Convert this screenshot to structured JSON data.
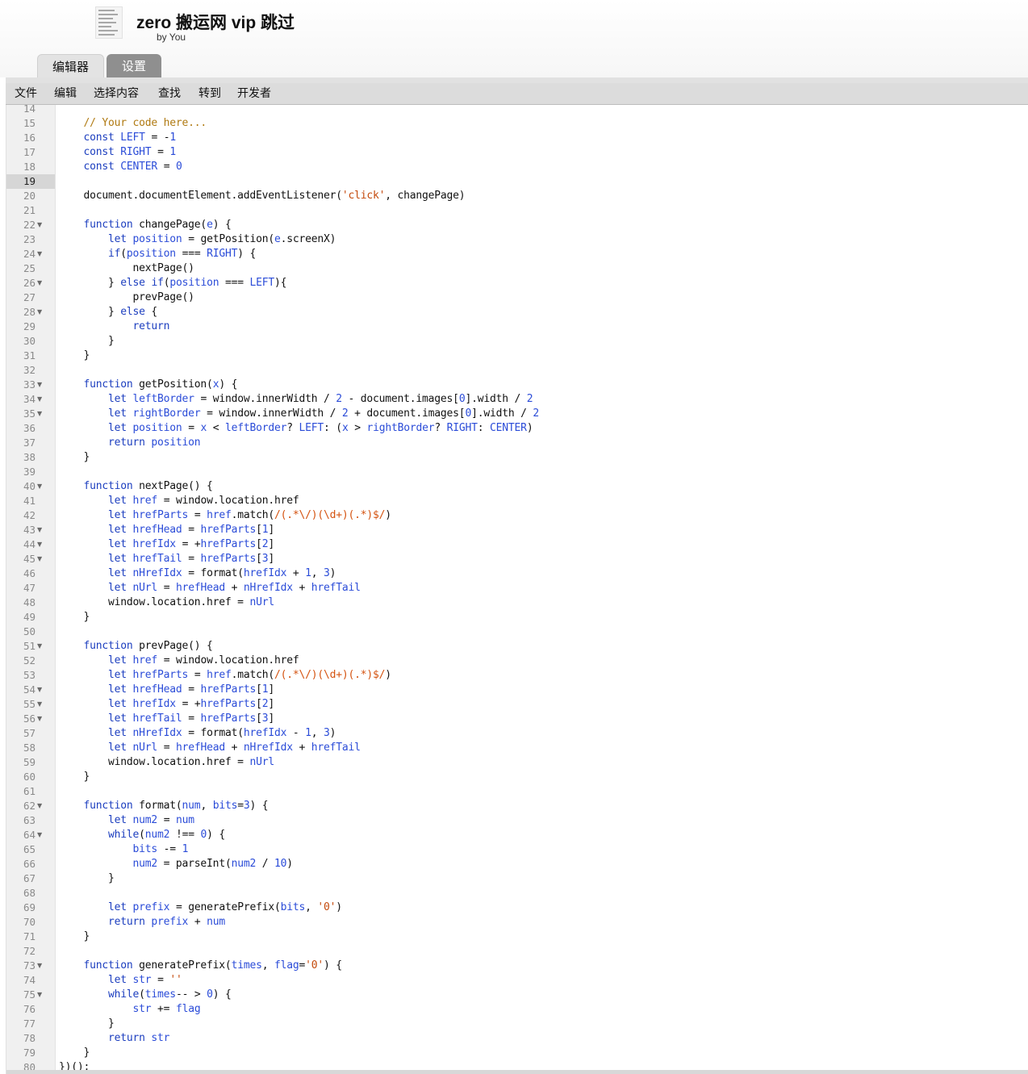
{
  "header": {
    "title": "zero 搬运网 vip 跳过",
    "author": "by You"
  },
  "tabs": [
    {
      "label": "编辑器",
      "active": true
    },
    {
      "label": "设置",
      "active": false
    }
  ],
  "menu": [
    "文件",
    "编辑",
    "选择内容",
    "查找",
    "转到",
    "开发者"
  ],
  "editor": {
    "active_line": 19,
    "fold_lines": [
      22,
      24,
      26,
      28,
      33,
      34,
      35,
      40,
      43,
      44,
      45,
      51,
      54,
      55,
      56,
      62,
      64,
      73,
      75
    ],
    "lines": [
      {
        "n": 14,
        "t": ""
      },
      {
        "n": 15,
        "t": "    // Your code here..."
      },
      {
        "n": 16,
        "t": "    const LEFT = -1"
      },
      {
        "n": 17,
        "t": "    const RIGHT = 1"
      },
      {
        "n": 18,
        "t": "    const CENTER = 0"
      },
      {
        "n": 19,
        "t": ""
      },
      {
        "n": 20,
        "t": "    document.documentElement.addEventListener('click', changePage)"
      },
      {
        "n": 21,
        "t": ""
      },
      {
        "n": 22,
        "t": "    function changePage(e) {"
      },
      {
        "n": 23,
        "t": "        let position = getPosition(e.screenX)"
      },
      {
        "n": 24,
        "t": "        if(position === RIGHT) {"
      },
      {
        "n": 25,
        "t": "            nextPage()"
      },
      {
        "n": 26,
        "t": "        } else if(position === LEFT){"
      },
      {
        "n": 27,
        "t": "            prevPage()"
      },
      {
        "n": 28,
        "t": "        } else {"
      },
      {
        "n": 29,
        "t": "            return"
      },
      {
        "n": 30,
        "t": "        }"
      },
      {
        "n": 31,
        "t": "    }"
      },
      {
        "n": 32,
        "t": ""
      },
      {
        "n": 33,
        "t": "    function getPosition(x) {"
      },
      {
        "n": 34,
        "t": "        let leftBorder = window.innerWidth / 2 - document.images[0].width / 2"
      },
      {
        "n": 35,
        "t": "        let rightBorder = window.innerWidth / 2 + document.images[0].width / 2"
      },
      {
        "n": 36,
        "t": "        let position = x < leftBorder? LEFT: (x > rightBorder? RIGHT: CENTER)"
      },
      {
        "n": 37,
        "t": "        return position"
      },
      {
        "n": 38,
        "t": "    }"
      },
      {
        "n": 39,
        "t": ""
      },
      {
        "n": 40,
        "t": "    function nextPage() {"
      },
      {
        "n": 41,
        "t": "        let href = window.location.href"
      },
      {
        "n": 42,
        "t": "        let hrefParts = href.match(/(.*\\/)(\\d+)(.*)$/)"
      },
      {
        "n": 43,
        "t": "        let hrefHead = hrefParts[1]"
      },
      {
        "n": 44,
        "t": "        let hrefIdx = +hrefParts[2]"
      },
      {
        "n": 45,
        "t": "        let hrefTail = hrefParts[3]"
      },
      {
        "n": 46,
        "t": "        let nHrefIdx = format(hrefIdx + 1, 3)"
      },
      {
        "n": 47,
        "t": "        let nUrl = hrefHead + nHrefIdx + hrefTail"
      },
      {
        "n": 48,
        "t": "        window.location.href = nUrl"
      },
      {
        "n": 49,
        "t": "    }"
      },
      {
        "n": 50,
        "t": ""
      },
      {
        "n": 51,
        "t": "    function prevPage() {"
      },
      {
        "n": 52,
        "t": "        let href = window.location.href"
      },
      {
        "n": 53,
        "t": "        let hrefParts = href.match(/(.*\\/)(\\d+)(.*)$/)"
      },
      {
        "n": 54,
        "t": "        let hrefHead = hrefParts[1]"
      },
      {
        "n": 55,
        "t": "        let hrefIdx = +hrefParts[2]"
      },
      {
        "n": 56,
        "t": "        let hrefTail = hrefParts[3]"
      },
      {
        "n": 57,
        "t": "        let nHrefIdx = format(hrefIdx - 1, 3)"
      },
      {
        "n": 58,
        "t": "        let nUrl = hrefHead + nHrefIdx + hrefTail"
      },
      {
        "n": 59,
        "t": "        window.location.href = nUrl"
      },
      {
        "n": 60,
        "t": "    }"
      },
      {
        "n": 61,
        "t": ""
      },
      {
        "n": 62,
        "t": "    function format(num, bits=3) {"
      },
      {
        "n": 63,
        "t": "        let num2 = num"
      },
      {
        "n": 64,
        "t": "        while(num2 !== 0) {"
      },
      {
        "n": 65,
        "t": "            bits -= 1"
      },
      {
        "n": 66,
        "t": "            num2 = parseInt(num2 / 10)"
      },
      {
        "n": 67,
        "t": "        }"
      },
      {
        "n": 68,
        "t": ""
      },
      {
        "n": 69,
        "t": "        let prefix = generatePrefix(bits, '0')"
      },
      {
        "n": 70,
        "t": "        return prefix + num"
      },
      {
        "n": 71,
        "t": "    }"
      },
      {
        "n": 72,
        "t": ""
      },
      {
        "n": 73,
        "t": "    function generatePrefix(times, flag='0') {"
      },
      {
        "n": 74,
        "t": "        let str = ''"
      },
      {
        "n": 75,
        "t": "        while(times-- > 0) {"
      },
      {
        "n": 76,
        "t": "            str += flag"
      },
      {
        "n": 77,
        "t": "        }"
      },
      {
        "n": 78,
        "t": "        return str"
      },
      {
        "n": 79,
        "t": "    }"
      },
      {
        "n": 80,
        "t": "})();"
      }
    ]
  }
}
